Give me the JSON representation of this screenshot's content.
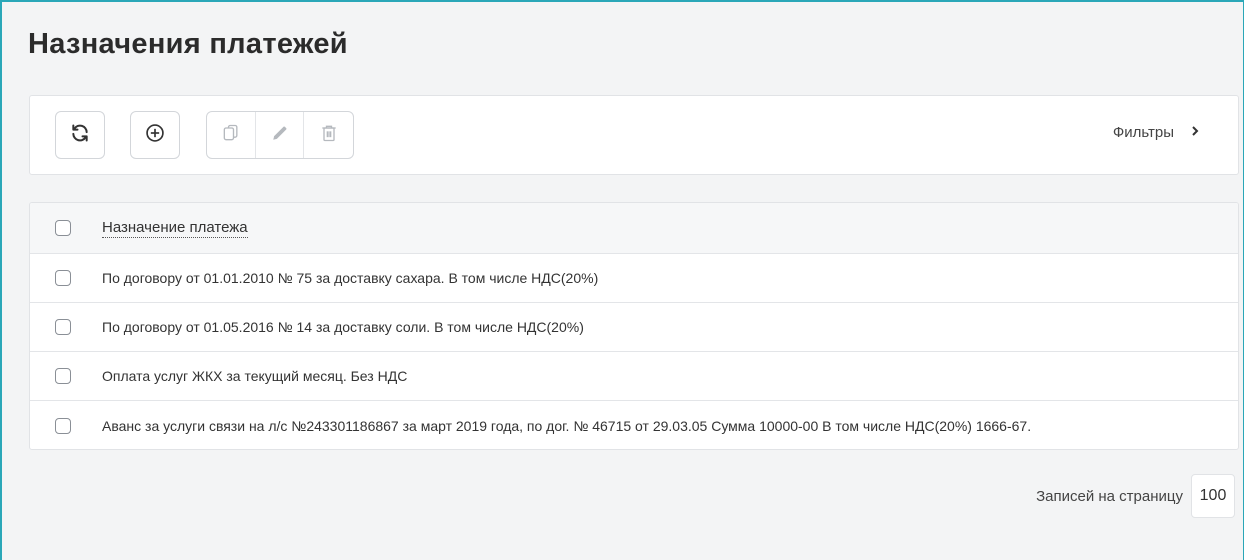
{
  "page": {
    "title": "Назначения платежей"
  },
  "toolbar": {
    "refresh_icon": "refresh-icon",
    "add_icon": "plus-circle-icon",
    "copy_icon": "copy-icon",
    "edit_icon": "pencil-icon",
    "delete_icon": "trash-icon",
    "filters_label": "Фильтры",
    "filters_chevron": "›"
  },
  "table": {
    "column_header": "Назначение платежа",
    "rows": [
      "По договору от 01.01.2010 № 75 за доставку сахара. В том числе НДС(20%)",
      "По договору от 01.05.2016 № 14 за доставку соли. В том числе НДС(20%)",
      "Оплата услуг ЖКХ за текущий месяц. Без НДС",
      "Аванс за услуги связи на л/с №243301186867 за март 2019 года, по дог. № 46715 от 29.03.05 Сумма 10000-00 В том числе НДС(20%) 1666-67."
    ]
  },
  "pagination": {
    "label": "Записей на страницу",
    "page_size": "100"
  },
  "colors": {
    "accent_border": "#2aa7b8",
    "background": "#f3f4f5",
    "panel": "#ffffff"
  }
}
